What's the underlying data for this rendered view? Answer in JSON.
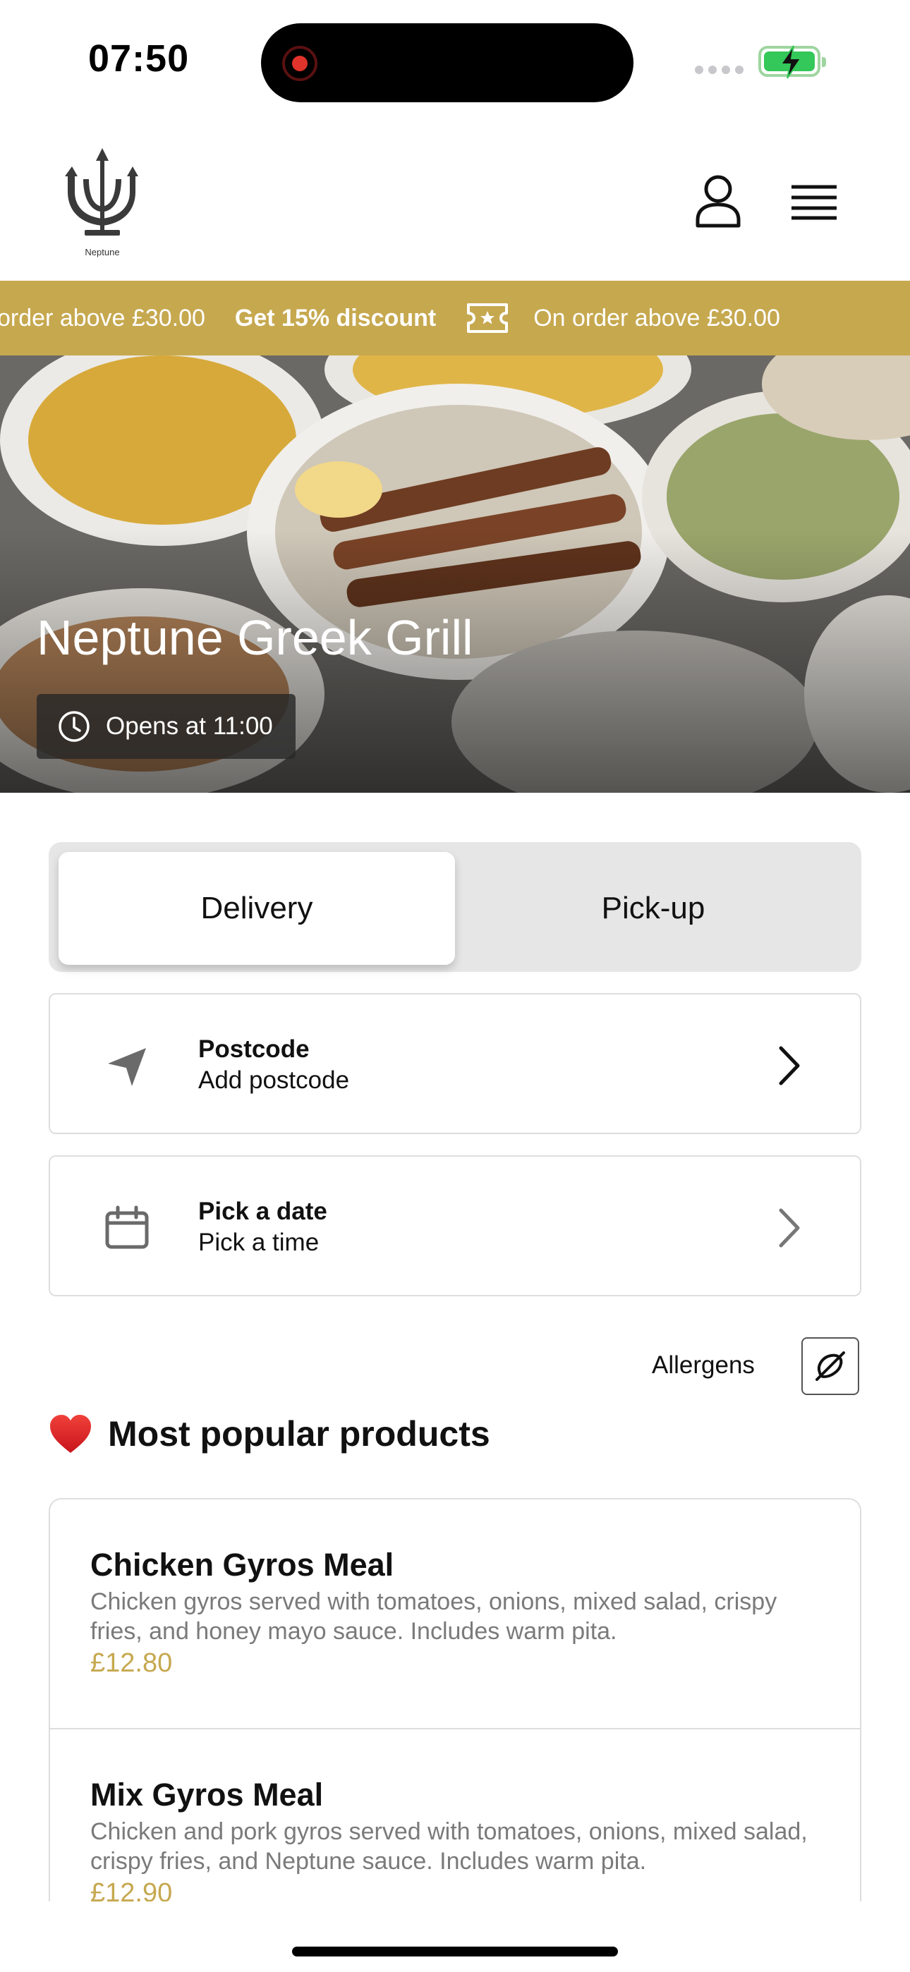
{
  "status_bar": {
    "time": "07:50"
  },
  "header": {
    "logo_text": "Neptune"
  },
  "banner": {
    "segments": [
      {
        "text": "order above £30.00",
        "bold": false
      },
      {
        "text": "Get 15% discount",
        "bold": true
      },
      {
        "text": "On order above £30.00",
        "bold": false
      }
    ],
    "accent_color": "#c6a84f"
  },
  "hero": {
    "title": "Neptune Greek Grill",
    "opening": "Opens at 11:00"
  },
  "order_mode": {
    "options": [
      "Delivery",
      "Pick-up"
    ],
    "selected": "Delivery"
  },
  "postcode_card": {
    "title": "Postcode",
    "subtitle": "Add postcode",
    "icon": "location-arrow-icon"
  },
  "date_card": {
    "title": "Pick a date",
    "subtitle": "Pick a time",
    "icon": "calendar-icon"
  },
  "allergens": {
    "label": "Allergens",
    "icon": "allergen-filter-icon"
  },
  "popular": {
    "heading": "Most popular products",
    "icon": "heart-icon",
    "products": [
      {
        "name": "Chicken Gyros Meal",
        "description": "Chicken gyros served with tomatoes, onions, mixed salad, crispy fries, and honey mayo sauce. Includes warm pita.",
        "price": "£12.80"
      },
      {
        "name": "Mix Gyros Meal",
        "description": "Chicken and pork gyros served with tomatoes, onions, mixed salad, crispy fries, and Neptune sauce. Includes warm pita.",
        "price": "£12.90"
      }
    ]
  }
}
